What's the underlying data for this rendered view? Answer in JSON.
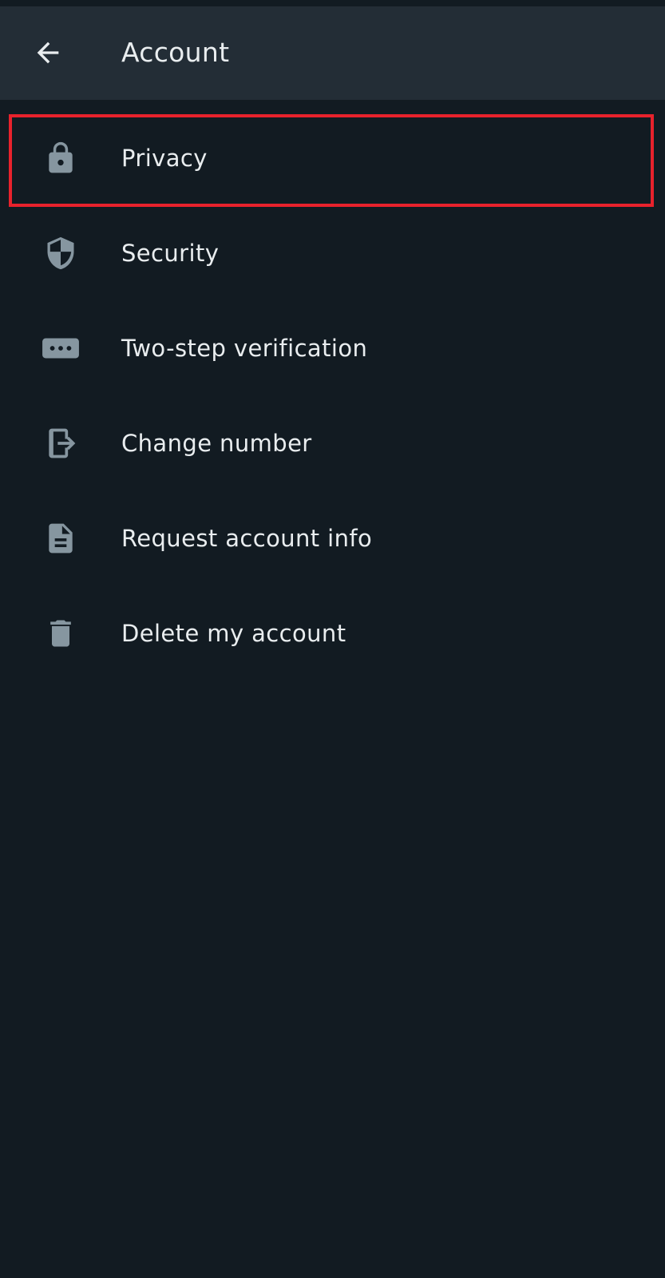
{
  "header": {
    "title": "Account",
    "back_icon": "arrow-left-icon"
  },
  "menu": {
    "items": [
      {
        "label": "Privacy",
        "icon": "lock-icon",
        "highlighted": true
      },
      {
        "label": "Security",
        "icon": "shield-icon"
      },
      {
        "label": "Two-step verification",
        "icon": "password-dots-icon"
      },
      {
        "label": "Change number",
        "icon": "change-number-icon"
      },
      {
        "label": "Request account info",
        "icon": "document-icon"
      },
      {
        "label": "Delete my account",
        "icon": "trash-icon"
      }
    ]
  },
  "colors": {
    "background": "#121b22",
    "app_bar": "#232d36",
    "text": "#e9edef",
    "icon": "#8696a0",
    "highlight": "#e8222c"
  }
}
